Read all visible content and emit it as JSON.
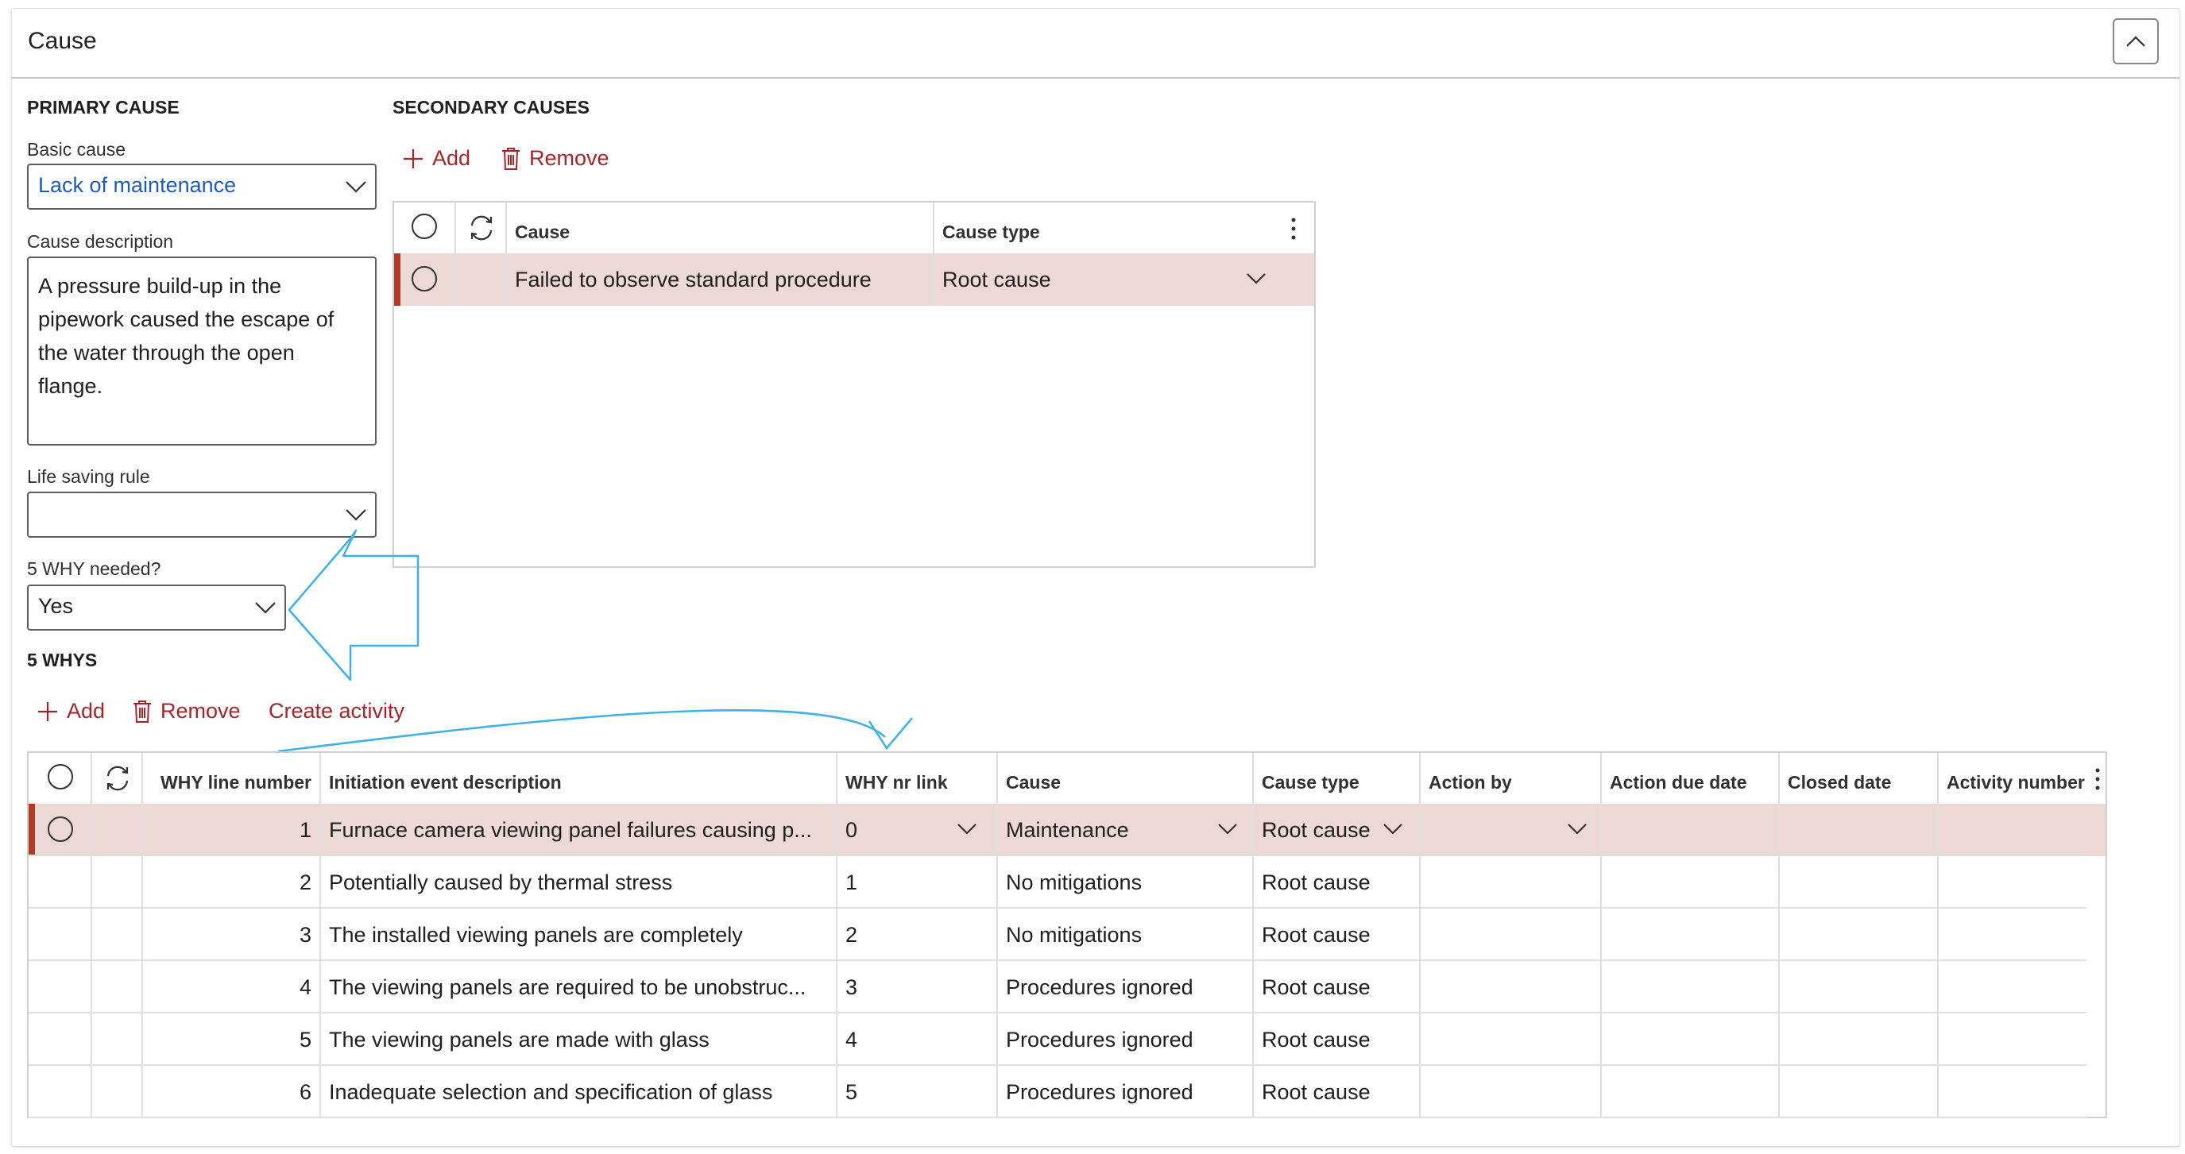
{
  "panel": {
    "title": "Cause"
  },
  "primary": {
    "heading": "PRIMARY CAUSE",
    "basic_cause_label": "Basic cause",
    "basic_cause_value": "Lack of maintenance",
    "cause_description_label": "Cause description",
    "cause_description_lines": [
      "A pressure build-up in the",
      "pipework caused the escape of",
      "the water through the open",
      "flange."
    ],
    "life_saving_rule_label": "Life saving rule",
    "life_saving_rule_value": "",
    "five_why_label": "5 WHY needed?",
    "five_why_value": "Yes"
  },
  "secondary": {
    "heading": "SECONDARY CAUSES",
    "add_label": "Add",
    "remove_label": "Remove",
    "columns": {
      "cause": "Cause",
      "cause_type": "Cause type"
    },
    "rows": [
      {
        "cause": "Failed to observe standard procedure",
        "cause_type": "Root cause"
      }
    ]
  },
  "whys": {
    "heading": "5 WHYS",
    "add_label": "Add",
    "remove_label": "Remove",
    "create_activity_label": "Create activity",
    "columns": {
      "line_number": "WHY line number",
      "description": "Initiation event description",
      "nr_link": "WHY nr link",
      "cause": "Cause",
      "cause_type": "Cause type",
      "action_by": "Action by",
      "action_due_date": "Action due date",
      "closed_date": "Closed date",
      "activity_number": "Activity number"
    },
    "rows": [
      {
        "line": "1",
        "description": "Furnace camera viewing panel failures causing p...",
        "link": "0",
        "cause": "Maintenance",
        "cause_type": "Root cause"
      },
      {
        "line": "2",
        "description": "Potentially caused by thermal stress",
        "link": "1",
        "cause": "No mitigations",
        "cause_type": "Root cause"
      },
      {
        "line": "3",
        "description": "The installed viewing panels are completely",
        "link": "2",
        "cause": "No mitigations",
        "cause_type": "Root cause"
      },
      {
        "line": "4",
        "description": "The viewing panels are required to be unobstruc...",
        "link": "3",
        "cause": "Procedures ignored",
        "cause_type": "Root cause"
      },
      {
        "line": "5",
        "description": "The viewing panels are made with glass",
        "link": "4",
        "cause": "Procedures ignored",
        "cause_type": "Root cause"
      },
      {
        "line": "6",
        "description": "Inadequate selection and specification of glass",
        "link": "5",
        "cause": "Procedures ignored",
        "cause_type": "Root cause"
      }
    ]
  },
  "colors": {
    "accent": "#a4262c",
    "link": "#1f5cb8",
    "selected_row": "#ecd9d5",
    "selected_bar": "#b23b26",
    "annotation": "#3fb0e8"
  },
  "icons": [
    "chevron-up-icon",
    "chevron-down-icon",
    "plus-icon",
    "trash-icon",
    "refresh-icon",
    "more-vertical-icon",
    "radio-icon"
  ]
}
